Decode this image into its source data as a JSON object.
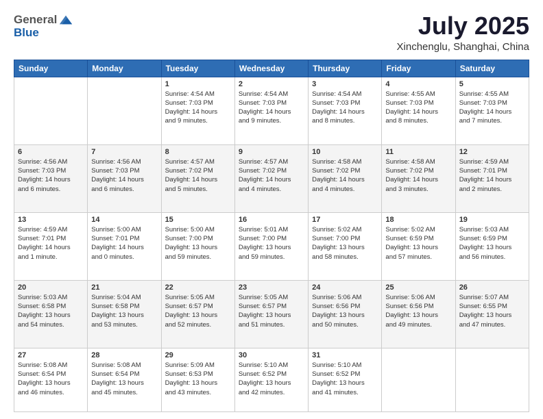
{
  "header": {
    "logo_line1": "General",
    "logo_line2": "Blue",
    "month": "July 2025",
    "location": "Xinchenglu, Shanghai, China"
  },
  "days_of_week": [
    "Sunday",
    "Monday",
    "Tuesday",
    "Wednesday",
    "Thursday",
    "Friday",
    "Saturday"
  ],
  "weeks": [
    [
      {
        "day": "",
        "info": ""
      },
      {
        "day": "",
        "info": ""
      },
      {
        "day": "1",
        "info": "Sunrise: 4:54 AM\nSunset: 7:03 PM\nDaylight: 14 hours\nand 9 minutes."
      },
      {
        "day": "2",
        "info": "Sunrise: 4:54 AM\nSunset: 7:03 PM\nDaylight: 14 hours\nand 9 minutes."
      },
      {
        "day": "3",
        "info": "Sunrise: 4:54 AM\nSunset: 7:03 PM\nDaylight: 14 hours\nand 8 minutes."
      },
      {
        "day": "4",
        "info": "Sunrise: 4:55 AM\nSunset: 7:03 PM\nDaylight: 14 hours\nand 8 minutes."
      },
      {
        "day": "5",
        "info": "Sunrise: 4:55 AM\nSunset: 7:03 PM\nDaylight: 14 hours\nand 7 minutes."
      }
    ],
    [
      {
        "day": "6",
        "info": "Sunrise: 4:56 AM\nSunset: 7:03 PM\nDaylight: 14 hours\nand 6 minutes."
      },
      {
        "day": "7",
        "info": "Sunrise: 4:56 AM\nSunset: 7:03 PM\nDaylight: 14 hours\nand 6 minutes."
      },
      {
        "day": "8",
        "info": "Sunrise: 4:57 AM\nSunset: 7:02 PM\nDaylight: 14 hours\nand 5 minutes."
      },
      {
        "day": "9",
        "info": "Sunrise: 4:57 AM\nSunset: 7:02 PM\nDaylight: 14 hours\nand 4 minutes."
      },
      {
        "day": "10",
        "info": "Sunrise: 4:58 AM\nSunset: 7:02 PM\nDaylight: 14 hours\nand 4 minutes."
      },
      {
        "day": "11",
        "info": "Sunrise: 4:58 AM\nSunset: 7:02 PM\nDaylight: 14 hours\nand 3 minutes."
      },
      {
        "day": "12",
        "info": "Sunrise: 4:59 AM\nSunset: 7:01 PM\nDaylight: 14 hours\nand 2 minutes."
      }
    ],
    [
      {
        "day": "13",
        "info": "Sunrise: 4:59 AM\nSunset: 7:01 PM\nDaylight: 14 hours\nand 1 minute."
      },
      {
        "day": "14",
        "info": "Sunrise: 5:00 AM\nSunset: 7:01 PM\nDaylight: 14 hours\nand 0 minutes."
      },
      {
        "day": "15",
        "info": "Sunrise: 5:00 AM\nSunset: 7:00 PM\nDaylight: 13 hours\nand 59 minutes."
      },
      {
        "day": "16",
        "info": "Sunrise: 5:01 AM\nSunset: 7:00 PM\nDaylight: 13 hours\nand 59 minutes."
      },
      {
        "day": "17",
        "info": "Sunrise: 5:02 AM\nSunset: 7:00 PM\nDaylight: 13 hours\nand 58 minutes."
      },
      {
        "day": "18",
        "info": "Sunrise: 5:02 AM\nSunset: 6:59 PM\nDaylight: 13 hours\nand 57 minutes."
      },
      {
        "day": "19",
        "info": "Sunrise: 5:03 AM\nSunset: 6:59 PM\nDaylight: 13 hours\nand 56 minutes."
      }
    ],
    [
      {
        "day": "20",
        "info": "Sunrise: 5:03 AM\nSunset: 6:58 PM\nDaylight: 13 hours\nand 54 minutes."
      },
      {
        "day": "21",
        "info": "Sunrise: 5:04 AM\nSunset: 6:58 PM\nDaylight: 13 hours\nand 53 minutes."
      },
      {
        "day": "22",
        "info": "Sunrise: 5:05 AM\nSunset: 6:57 PM\nDaylight: 13 hours\nand 52 minutes."
      },
      {
        "day": "23",
        "info": "Sunrise: 5:05 AM\nSunset: 6:57 PM\nDaylight: 13 hours\nand 51 minutes."
      },
      {
        "day": "24",
        "info": "Sunrise: 5:06 AM\nSunset: 6:56 PM\nDaylight: 13 hours\nand 50 minutes."
      },
      {
        "day": "25",
        "info": "Sunrise: 5:06 AM\nSunset: 6:56 PM\nDaylight: 13 hours\nand 49 minutes."
      },
      {
        "day": "26",
        "info": "Sunrise: 5:07 AM\nSunset: 6:55 PM\nDaylight: 13 hours\nand 47 minutes."
      }
    ],
    [
      {
        "day": "27",
        "info": "Sunrise: 5:08 AM\nSunset: 6:54 PM\nDaylight: 13 hours\nand 46 minutes."
      },
      {
        "day": "28",
        "info": "Sunrise: 5:08 AM\nSunset: 6:54 PM\nDaylight: 13 hours\nand 45 minutes."
      },
      {
        "day": "29",
        "info": "Sunrise: 5:09 AM\nSunset: 6:53 PM\nDaylight: 13 hours\nand 43 minutes."
      },
      {
        "day": "30",
        "info": "Sunrise: 5:10 AM\nSunset: 6:52 PM\nDaylight: 13 hours\nand 42 minutes."
      },
      {
        "day": "31",
        "info": "Sunrise: 5:10 AM\nSunset: 6:52 PM\nDaylight: 13 hours\nand 41 minutes."
      },
      {
        "day": "",
        "info": ""
      },
      {
        "day": "",
        "info": ""
      }
    ]
  ]
}
